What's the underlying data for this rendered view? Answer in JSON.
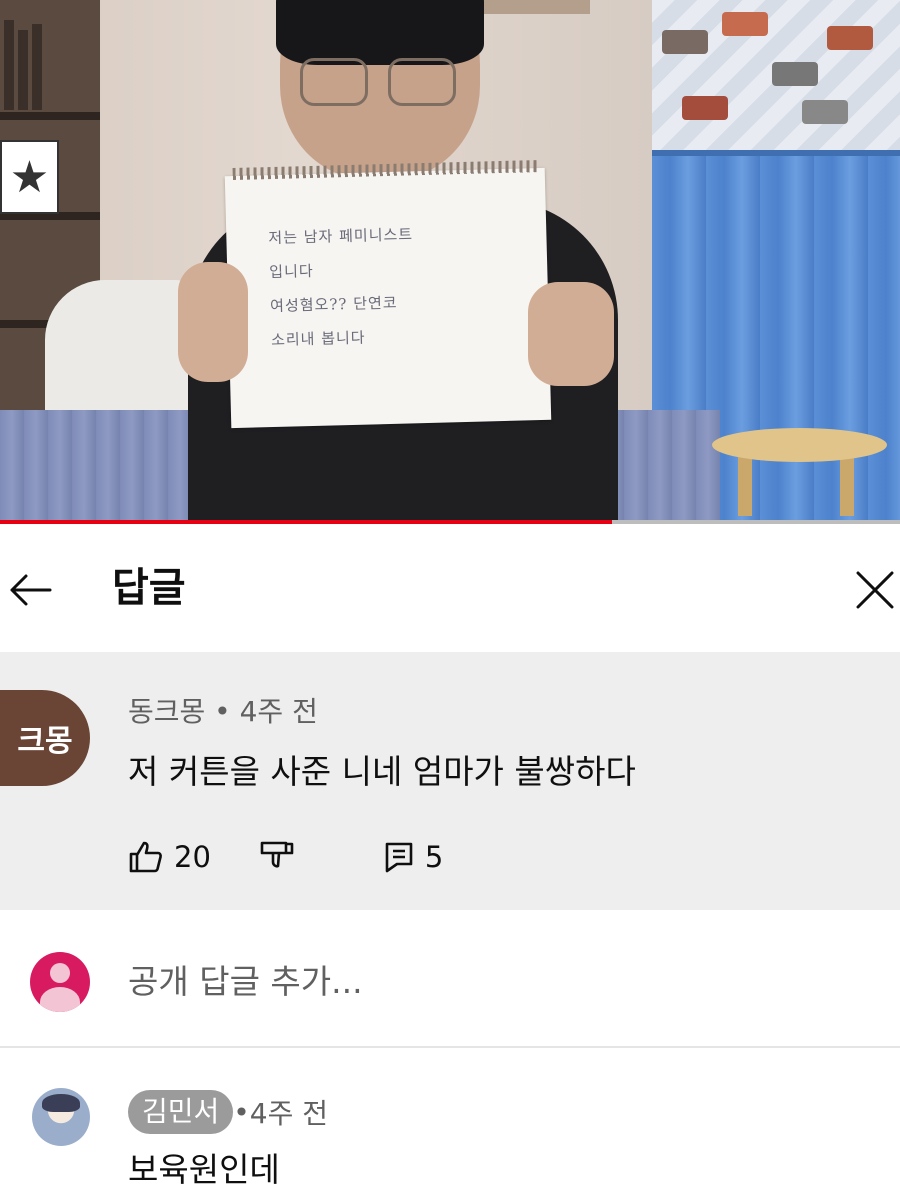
{
  "video": {
    "sign_text": "저는 남자 페미니스트\n입니다\n여성혐오?? 단연코\n소리내 봅니다",
    "progress_fraction": 0.68,
    "colors": {
      "progress": "#e60012",
      "track": "#bdbdbd"
    }
  },
  "header": {
    "back_icon": "arrow-left-icon",
    "title": "답글",
    "close_icon": "close-x-icon"
  },
  "comment": {
    "avatar_text": "크몽",
    "author": "동크몽",
    "separator": " • ",
    "time": "4주 전",
    "text": "저 커튼을 사준 니네 엄마가 불쌍하다",
    "likes": "20",
    "replies": "5",
    "icons": [
      "thumbs-up-icon",
      "thumbs-down-icon",
      "reply-icon"
    ]
  },
  "add_reply": {
    "placeholder": "공개 답글 추가..."
  },
  "reply": {
    "author": "김민서",
    "separator": " • ",
    "time": "4주 전",
    "text": "보육원인데"
  },
  "colors": {
    "comment_bg": "#eeeeee",
    "avatar_brown": "#6a4535",
    "avatar_pink": "#d81b60",
    "secondary_text": "#606060"
  }
}
